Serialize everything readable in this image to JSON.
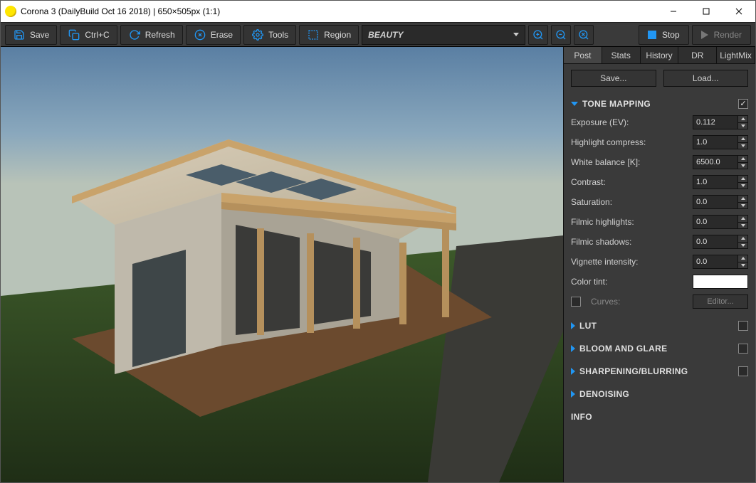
{
  "window": {
    "title": "Corona 3 (DailyBuild Oct 16 2018) | 650×505px (1:1)"
  },
  "toolbar": {
    "save": "Save",
    "ctrlc": "Ctrl+C",
    "refresh": "Refresh",
    "erase": "Erase",
    "tools": "Tools",
    "region": "Region",
    "pass": "BEAUTY",
    "stop": "Stop",
    "render": "Render"
  },
  "tabs": {
    "post": "Post",
    "stats": "Stats",
    "history": "History",
    "dr": "DR",
    "lightmix": "LightMix"
  },
  "panel": {
    "save_btn": "Save...",
    "load_btn": "Load..."
  },
  "sections": {
    "tone_mapping": "TONE MAPPING",
    "lut": "LUT",
    "bloom": "BLOOM AND GLARE",
    "sharpen": "SHARPENING/BLURRING",
    "denoise": "DENOISING",
    "info": "INFO"
  },
  "tone": {
    "exposure_label": "Exposure (EV):",
    "exposure_val": "0.112",
    "highlight_label": "Highlight compress:",
    "highlight_val": "1.0",
    "wb_label": "White balance [K]:",
    "wb_val": "6500.0",
    "contrast_label": "Contrast:",
    "contrast_val": "1.0",
    "saturation_label": "Saturation:",
    "saturation_val": "0.0",
    "filmic_hl_label": "Filmic highlights:",
    "filmic_hl_val": "0.0",
    "filmic_sh_label": "Filmic shadows:",
    "filmic_sh_val": "0.0",
    "vignette_label": "Vignette intensity:",
    "vignette_val": "0.0",
    "tint_label": "Color tint:",
    "tint_color": "#ffffff",
    "curves_label": "Curves:",
    "editor_btn": "Editor..."
  }
}
